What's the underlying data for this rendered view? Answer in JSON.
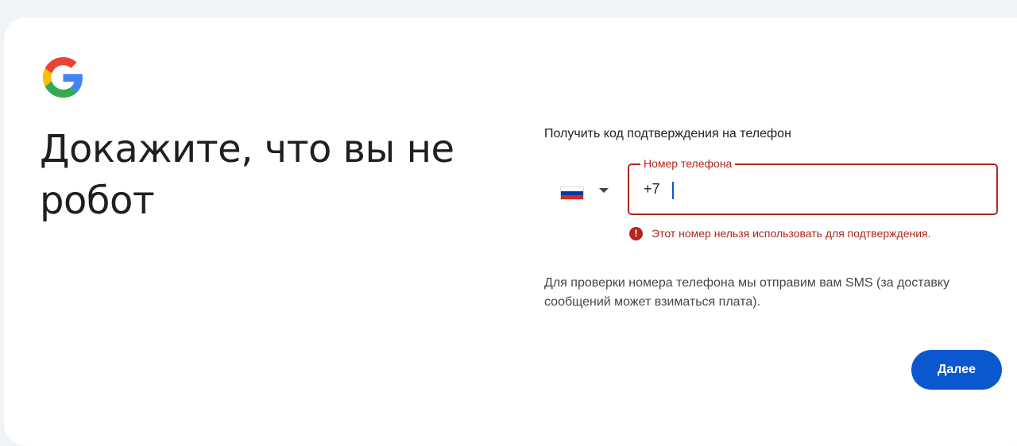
{
  "logo": {
    "name": "google-logo-icon"
  },
  "page": {
    "title": "Докажите, что вы не робот",
    "subtitle": "Получить код подтверждения на телефон"
  },
  "country_selector": {
    "country": "Russia",
    "flag_colors": [
      "#ffffff",
      "#0039a6",
      "#d52b1e"
    ]
  },
  "phone_field": {
    "label": "Номер телефона",
    "value": "+7"
  },
  "error": {
    "icon": "error-icon",
    "text": "Этот номер нельзя использовать для подтверждения."
  },
  "note": "Для проверки номера телефона мы отправим вам SMS (за доставку сообщений может взиматься плата).",
  "actions": {
    "next_label": "Далее"
  },
  "colors": {
    "accent": "#0b57d0",
    "error": "#b3261e",
    "background": "#f0f4f9"
  }
}
